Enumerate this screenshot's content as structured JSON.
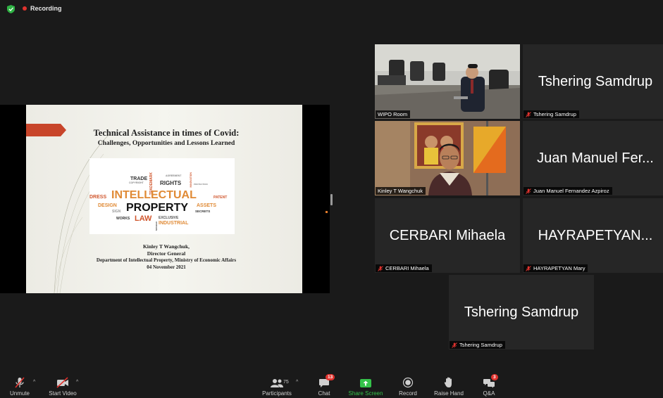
{
  "status": {
    "recording_label": "Recording"
  },
  "slide": {
    "title": "Technical Assistance in times of Covid:",
    "subtitle": "Challenges, Opportunities and Lessons Learned",
    "cloud_words": {
      "trade": "TRADE",
      "copyright": "COPYRIGHT",
      "trademark": "TRADEMARK",
      "agreement": "AGREEMENT",
      "innovation": "INNOVATION",
      "rights": "RIGHTS",
      "protection": "PROTECTION",
      "dress": "DRESS",
      "intellectual": "INTELLECTUAL",
      "patent": "PATENT",
      "design": "DESIGN",
      "property": "PROPERTY",
      "assets": "ASSETS",
      "sign": "SIGN",
      "secrets": "SECRETS",
      "works": "WORKS",
      "law": "LAW",
      "exclusive": "EXCLUSIVE",
      "industrial": "INDUSTRIAL",
      "number": "NUMBER"
    },
    "author_name": "Kinley T Wangchuk,",
    "author_role": "Director General",
    "author_dept": "Department of Intellectual Property, Ministry of Economic Affairs",
    "date": "04 November 2021"
  },
  "tiles": [
    {
      "name": "WIPO Room",
      "big": "",
      "muted": false
    },
    {
      "name": "Tshering Samdrup",
      "big": "Tshering Samdrup",
      "muted": true
    },
    {
      "name": "Kinley T Wangchuk",
      "big": "",
      "muted": false
    },
    {
      "name": "Juan Manuel Fernandez Azpiroz",
      "big": "Juan Manuel Fer...",
      "muted": true
    },
    {
      "name": "CERBARI Mihaela",
      "big": "CERBARI Mihaela",
      "muted": true
    },
    {
      "name": "HAYRAPETYAN Mary",
      "big": "HAYRAPETYAN...",
      "muted": true
    },
    {
      "name": "Tshering Samdrup",
      "big": "Tshering Samdrup",
      "muted": true
    }
  ],
  "toolbar": {
    "unmute": "Unmute",
    "start_video": "Start Video",
    "participants": "Participants",
    "participants_count": "75",
    "chat": "Chat",
    "chat_badge": "13",
    "share_screen": "Share Screen",
    "record": "Record",
    "raise_hand": "Raise Hand",
    "qa": "Q&A",
    "qa_badge": "3"
  },
  "colors": {
    "accent_green": "#35c24a",
    "record_red": "#e0332e",
    "active_speaker": "#d4e05a",
    "slide_orange": "#c8452a"
  }
}
